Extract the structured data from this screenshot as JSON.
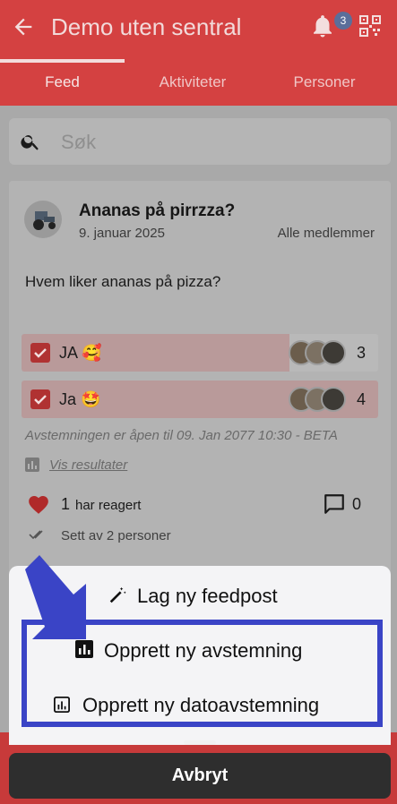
{
  "app": {
    "title": "Demo uten sentral",
    "notification_count": "3"
  },
  "tabs": [
    {
      "label": "Feed"
    },
    {
      "label": "Aktiviteter"
    },
    {
      "label": "Personer"
    }
  ],
  "search": {
    "placeholder": "Søk"
  },
  "post": {
    "title": "Ananas på pirrzza?",
    "date": "9. januar 2025",
    "audience": "Alle medlemmer",
    "question": "Hvem liker ananas på pizza?",
    "options": [
      {
        "label": "JA 🥰",
        "count": "3",
        "checked": true,
        "share": 0.75
      },
      {
        "label": "Ja 🤩",
        "count": "4",
        "checked": true,
        "share": 1.0
      }
    ],
    "vote_note": "Avstemningen er åpen til 09. Jan 2077 10:30 - BETA",
    "results_link": "Vis resultater",
    "reactions_count": "1",
    "reactions_label": "har reagert",
    "comments_count": "0",
    "seen_label": "Sett av 2 personer"
  },
  "sheet": {
    "items": [
      {
        "label": "Lag ny feedpost",
        "icon": "magic-pen-icon"
      },
      {
        "label": "Opprett ny avstemning",
        "icon": "bar-chart-icon"
      },
      {
        "label": "Opprett ny datoavstemning",
        "icon": "bar-chart-icon"
      }
    ],
    "cancel_label": "Avbryt"
  },
  "colors": {
    "brand_red": "#e53935",
    "highlight": "#3a44c6"
  }
}
